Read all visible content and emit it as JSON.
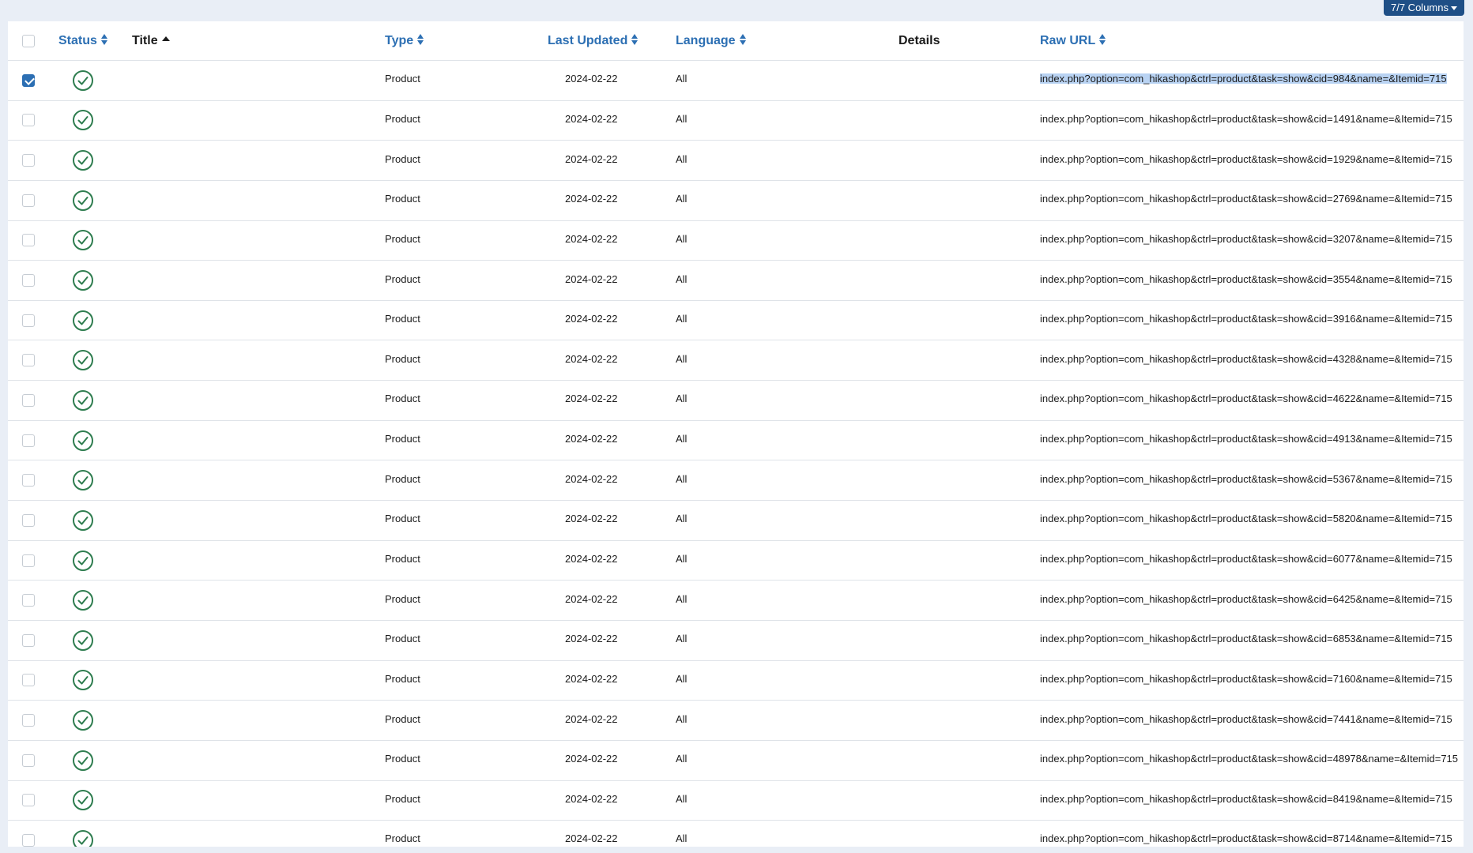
{
  "columns_button": {
    "label": "7/7 Columns"
  },
  "headers": {
    "status": "Status",
    "title": "Title",
    "type": "Type",
    "last_updated": "Last Updated",
    "language": "Language",
    "details": "Details",
    "raw_url": "Raw URL"
  },
  "rows": [
    {
      "checked": true,
      "type": "Product",
      "last_updated": "2024-02-22",
      "language": "All",
      "raw_url": "index.php?option=com_hikashop&ctrl=product&task=show&cid=984&name=&Itemid=715"
    },
    {
      "checked": false,
      "type": "Product",
      "last_updated": "2024-02-22",
      "language": "All",
      "raw_url": "index.php?option=com_hikashop&ctrl=product&task=show&cid=1491&name=&Itemid=715"
    },
    {
      "checked": false,
      "type": "Product",
      "last_updated": "2024-02-22",
      "language": "All",
      "raw_url": "index.php?option=com_hikashop&ctrl=product&task=show&cid=1929&name=&Itemid=715"
    },
    {
      "checked": false,
      "type": "Product",
      "last_updated": "2024-02-22",
      "language": "All",
      "raw_url": "index.php?option=com_hikashop&ctrl=product&task=show&cid=2769&name=&Itemid=715"
    },
    {
      "checked": false,
      "type": "Product",
      "last_updated": "2024-02-22",
      "language": "All",
      "raw_url": "index.php?option=com_hikashop&ctrl=product&task=show&cid=3207&name=&Itemid=715"
    },
    {
      "checked": false,
      "type": "Product",
      "last_updated": "2024-02-22",
      "language": "All",
      "raw_url": "index.php?option=com_hikashop&ctrl=product&task=show&cid=3554&name=&Itemid=715"
    },
    {
      "checked": false,
      "type": "Product",
      "last_updated": "2024-02-22",
      "language": "All",
      "raw_url": "index.php?option=com_hikashop&ctrl=product&task=show&cid=3916&name=&Itemid=715"
    },
    {
      "checked": false,
      "type": "Product",
      "last_updated": "2024-02-22",
      "language": "All",
      "raw_url": "index.php?option=com_hikashop&ctrl=product&task=show&cid=4328&name=&Itemid=715"
    },
    {
      "checked": false,
      "type": "Product",
      "last_updated": "2024-02-22",
      "language": "All",
      "raw_url": "index.php?option=com_hikashop&ctrl=product&task=show&cid=4622&name=&Itemid=715"
    },
    {
      "checked": false,
      "type": "Product",
      "last_updated": "2024-02-22",
      "language": "All",
      "raw_url": "index.php?option=com_hikashop&ctrl=product&task=show&cid=4913&name=&Itemid=715"
    },
    {
      "checked": false,
      "type": "Product",
      "last_updated": "2024-02-22",
      "language": "All",
      "raw_url": "index.php?option=com_hikashop&ctrl=product&task=show&cid=5367&name=&Itemid=715"
    },
    {
      "checked": false,
      "type": "Product",
      "last_updated": "2024-02-22",
      "language": "All",
      "raw_url": "index.php?option=com_hikashop&ctrl=product&task=show&cid=5820&name=&Itemid=715"
    },
    {
      "checked": false,
      "type": "Product",
      "last_updated": "2024-02-22",
      "language": "All",
      "raw_url": "index.php?option=com_hikashop&ctrl=product&task=show&cid=6077&name=&Itemid=715"
    },
    {
      "checked": false,
      "type": "Product",
      "last_updated": "2024-02-22",
      "language": "All",
      "raw_url": "index.php?option=com_hikashop&ctrl=product&task=show&cid=6425&name=&Itemid=715"
    },
    {
      "checked": false,
      "type": "Product",
      "last_updated": "2024-02-22",
      "language": "All",
      "raw_url": "index.php?option=com_hikashop&ctrl=product&task=show&cid=6853&name=&Itemid=715"
    },
    {
      "checked": false,
      "type": "Product",
      "last_updated": "2024-02-22",
      "language": "All",
      "raw_url": "index.php?option=com_hikashop&ctrl=product&task=show&cid=7160&name=&Itemid=715"
    },
    {
      "checked": false,
      "type": "Product",
      "last_updated": "2024-02-22",
      "language": "All",
      "raw_url": "index.php?option=com_hikashop&ctrl=product&task=show&cid=7441&name=&Itemid=715"
    },
    {
      "checked": false,
      "type": "Product",
      "last_updated": "2024-02-22",
      "language": "All",
      "raw_url": "index.php?option=com_hikashop&ctrl=product&task=show&cid=48978&name=&Itemid=715"
    },
    {
      "checked": false,
      "type": "Product",
      "last_updated": "2024-02-22",
      "language": "All",
      "raw_url": "index.php?option=com_hikashop&ctrl=product&task=show&cid=8419&name=&Itemid=715"
    },
    {
      "checked": false,
      "type": "Product",
      "last_updated": "2024-02-22",
      "language": "All",
      "raw_url": "index.php?option=com_hikashop&ctrl=product&task=show&cid=8714&name=&Itemid=715"
    }
  ],
  "icons": {
    "status_published": "check-circle-icon",
    "sortable": "sort-icon",
    "sort_ascending": "sort-ascending-icon"
  },
  "colors": {
    "link": "#2c6fb3",
    "status_ok": "#2e7d4f",
    "checkbox_checked": "#2c6fb3",
    "selection_highlight": "#b9d3f3",
    "columns_button_bg": "#1f4f86",
    "page_background": "#e9eef6"
  }
}
